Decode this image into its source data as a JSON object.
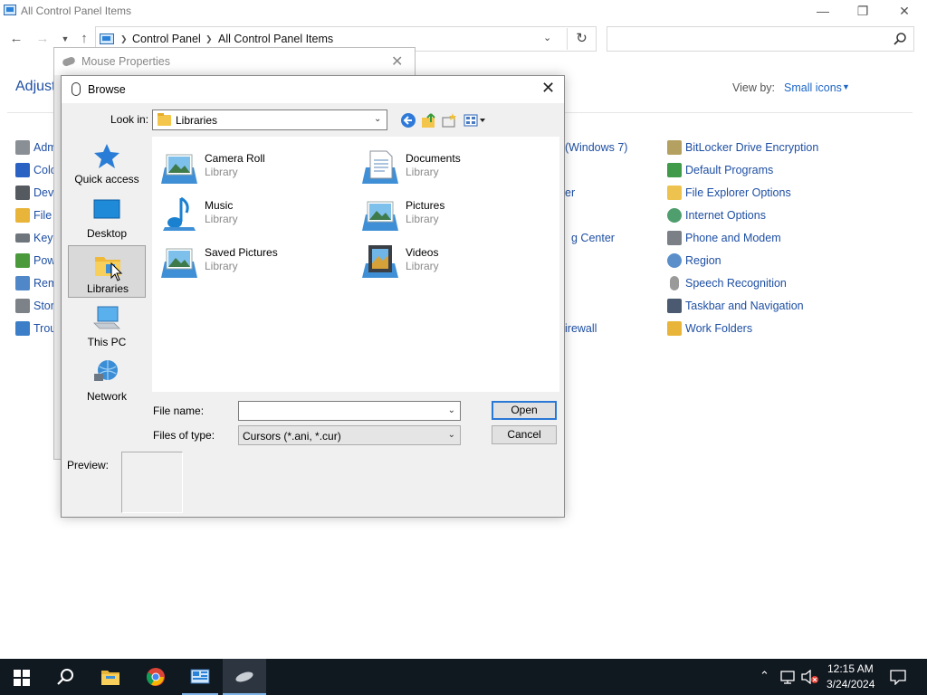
{
  "control_panel": {
    "title": "All Control Panel Items",
    "breadcrumb": [
      "Control Panel",
      "All Control Panel Items"
    ],
    "heading": "Adjust",
    "view_by_label": "View by:",
    "view_by_value": "Small icons",
    "left_items": [
      "Adm",
      "Colo",
      "Devi",
      "File",
      "Keyb",
      "Pow",
      "Rem",
      "Stor",
      "Trou"
    ],
    "middle_items": [
      "(Windows 7)",
      "er",
      "g Center",
      "irewall"
    ],
    "right_items": [
      "BitLocker Drive Encryption",
      "Default Programs",
      "File Explorer Options",
      "Internet Options",
      "Phone and Modem",
      "Region",
      "Speech Recognition",
      "Taskbar and Navigation",
      "Work Folders"
    ]
  },
  "mouse_properties": {
    "title": "Mouse Properties"
  },
  "browse": {
    "title": "Browse",
    "look_in_label": "Look in:",
    "look_in_value": "Libraries",
    "places": [
      "Quick access",
      "Desktop",
      "Libraries",
      "This PC",
      "Network"
    ],
    "selected_place": "Libraries",
    "files": [
      {
        "name": "Camera Roll",
        "type": "Library",
        "icon": "pictures-library-icon"
      },
      {
        "name": "Documents",
        "type": "Library",
        "icon": "documents-library-icon"
      },
      {
        "name": "Music",
        "type": "Library",
        "icon": "music-library-icon"
      },
      {
        "name": "Pictures",
        "type": "Library",
        "icon": "pictures-library-icon"
      },
      {
        "name": "Saved Pictures",
        "type": "Library",
        "icon": "pictures-library-icon"
      },
      {
        "name": "Videos",
        "type": "Library",
        "icon": "videos-library-icon"
      }
    ],
    "file_name_label": "File name:",
    "file_name_value": "",
    "files_of_type_label": "Files of type:",
    "files_of_type_value": "Cursors (*.ani, *.cur)",
    "open_label": "Open",
    "cancel_label": "Cancel",
    "preview_label": "Preview:"
  },
  "taskbar": {
    "apps": [
      "start-icon",
      "search-icon",
      "file-explorer-icon",
      "chrome-icon",
      "control-panel-icon",
      "mouse-properties-icon"
    ],
    "time": "12:15 AM",
    "date": "3/24/2024"
  },
  "colors": {
    "link_blue": "#1e4fa3",
    "accent_blue": "#2a78d6",
    "taskbar": "#101820"
  }
}
